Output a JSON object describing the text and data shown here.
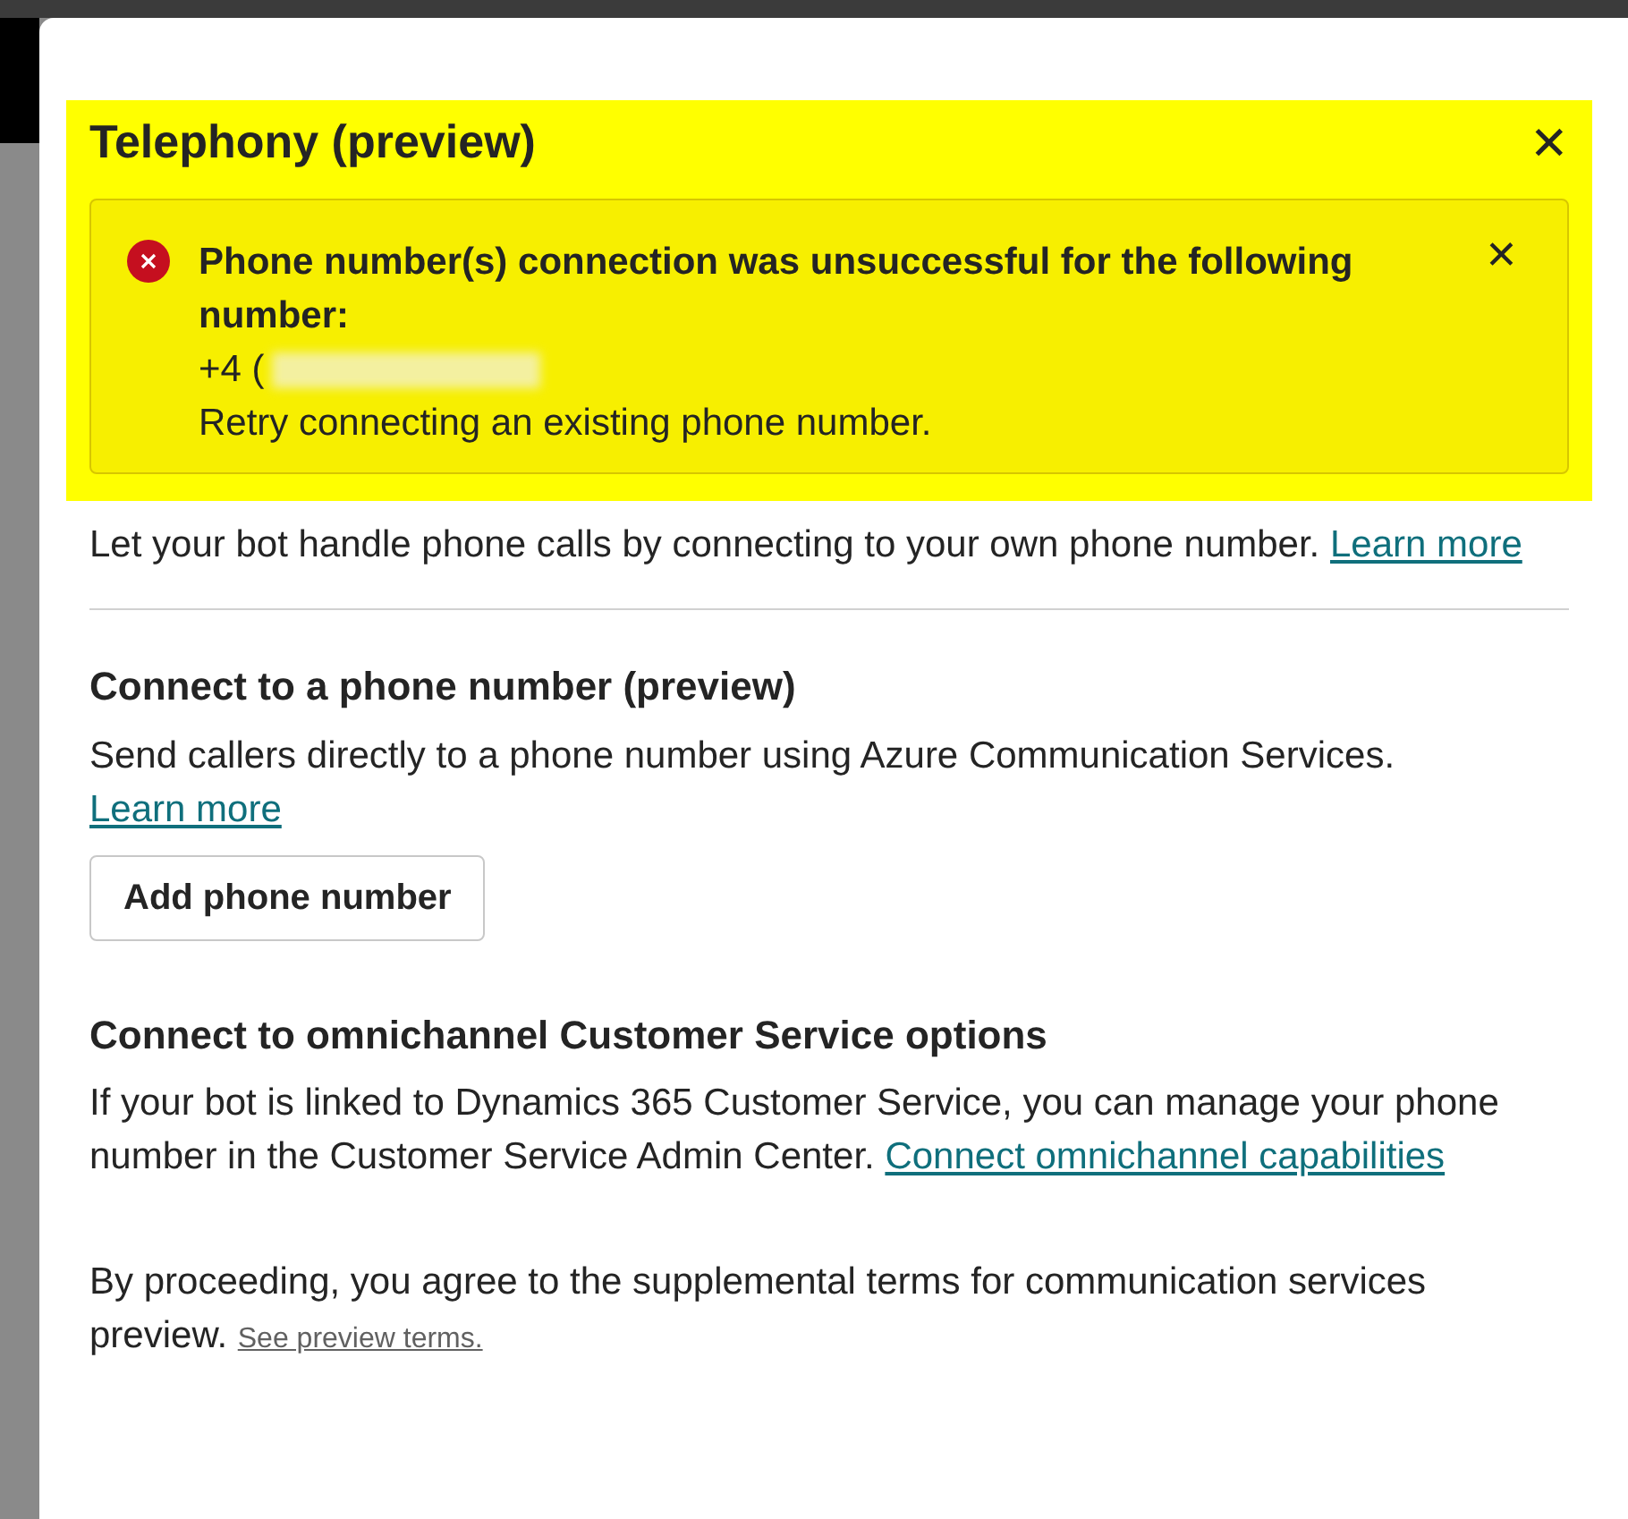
{
  "dialog": {
    "title": "Telephony (preview)",
    "close_label": "✕"
  },
  "alert": {
    "highlighted": true,
    "heading": "Phone number(s) connection was unsuccessful for the following number:",
    "phone_prefix": "+4 (",
    "phone_redacted": true,
    "message": "Retry connecting an existing phone number.",
    "dismiss_label": "✕"
  },
  "intro": {
    "text": "Let your bot handle phone calls by connecting to your own phone number.",
    "link": "Learn more"
  },
  "sections": [
    {
      "heading": "Connect to a phone number (preview)",
      "text": "Send callers directly to a phone number using Azure Communication Services.",
      "link": "Learn more",
      "button": "Add phone number"
    },
    {
      "heading": "Connect to omnichannel Customer Service options",
      "text": "If your bot is linked to Dynamics 365 Customer Service, you can manage your phone number in the Customer Service Admin Center.",
      "link": "Connect omnichannel capabilities"
    }
  ],
  "footer": {
    "text": "By proceeding, you agree to the supplemental terms for communication services preview.",
    "link": "See preview terms."
  }
}
